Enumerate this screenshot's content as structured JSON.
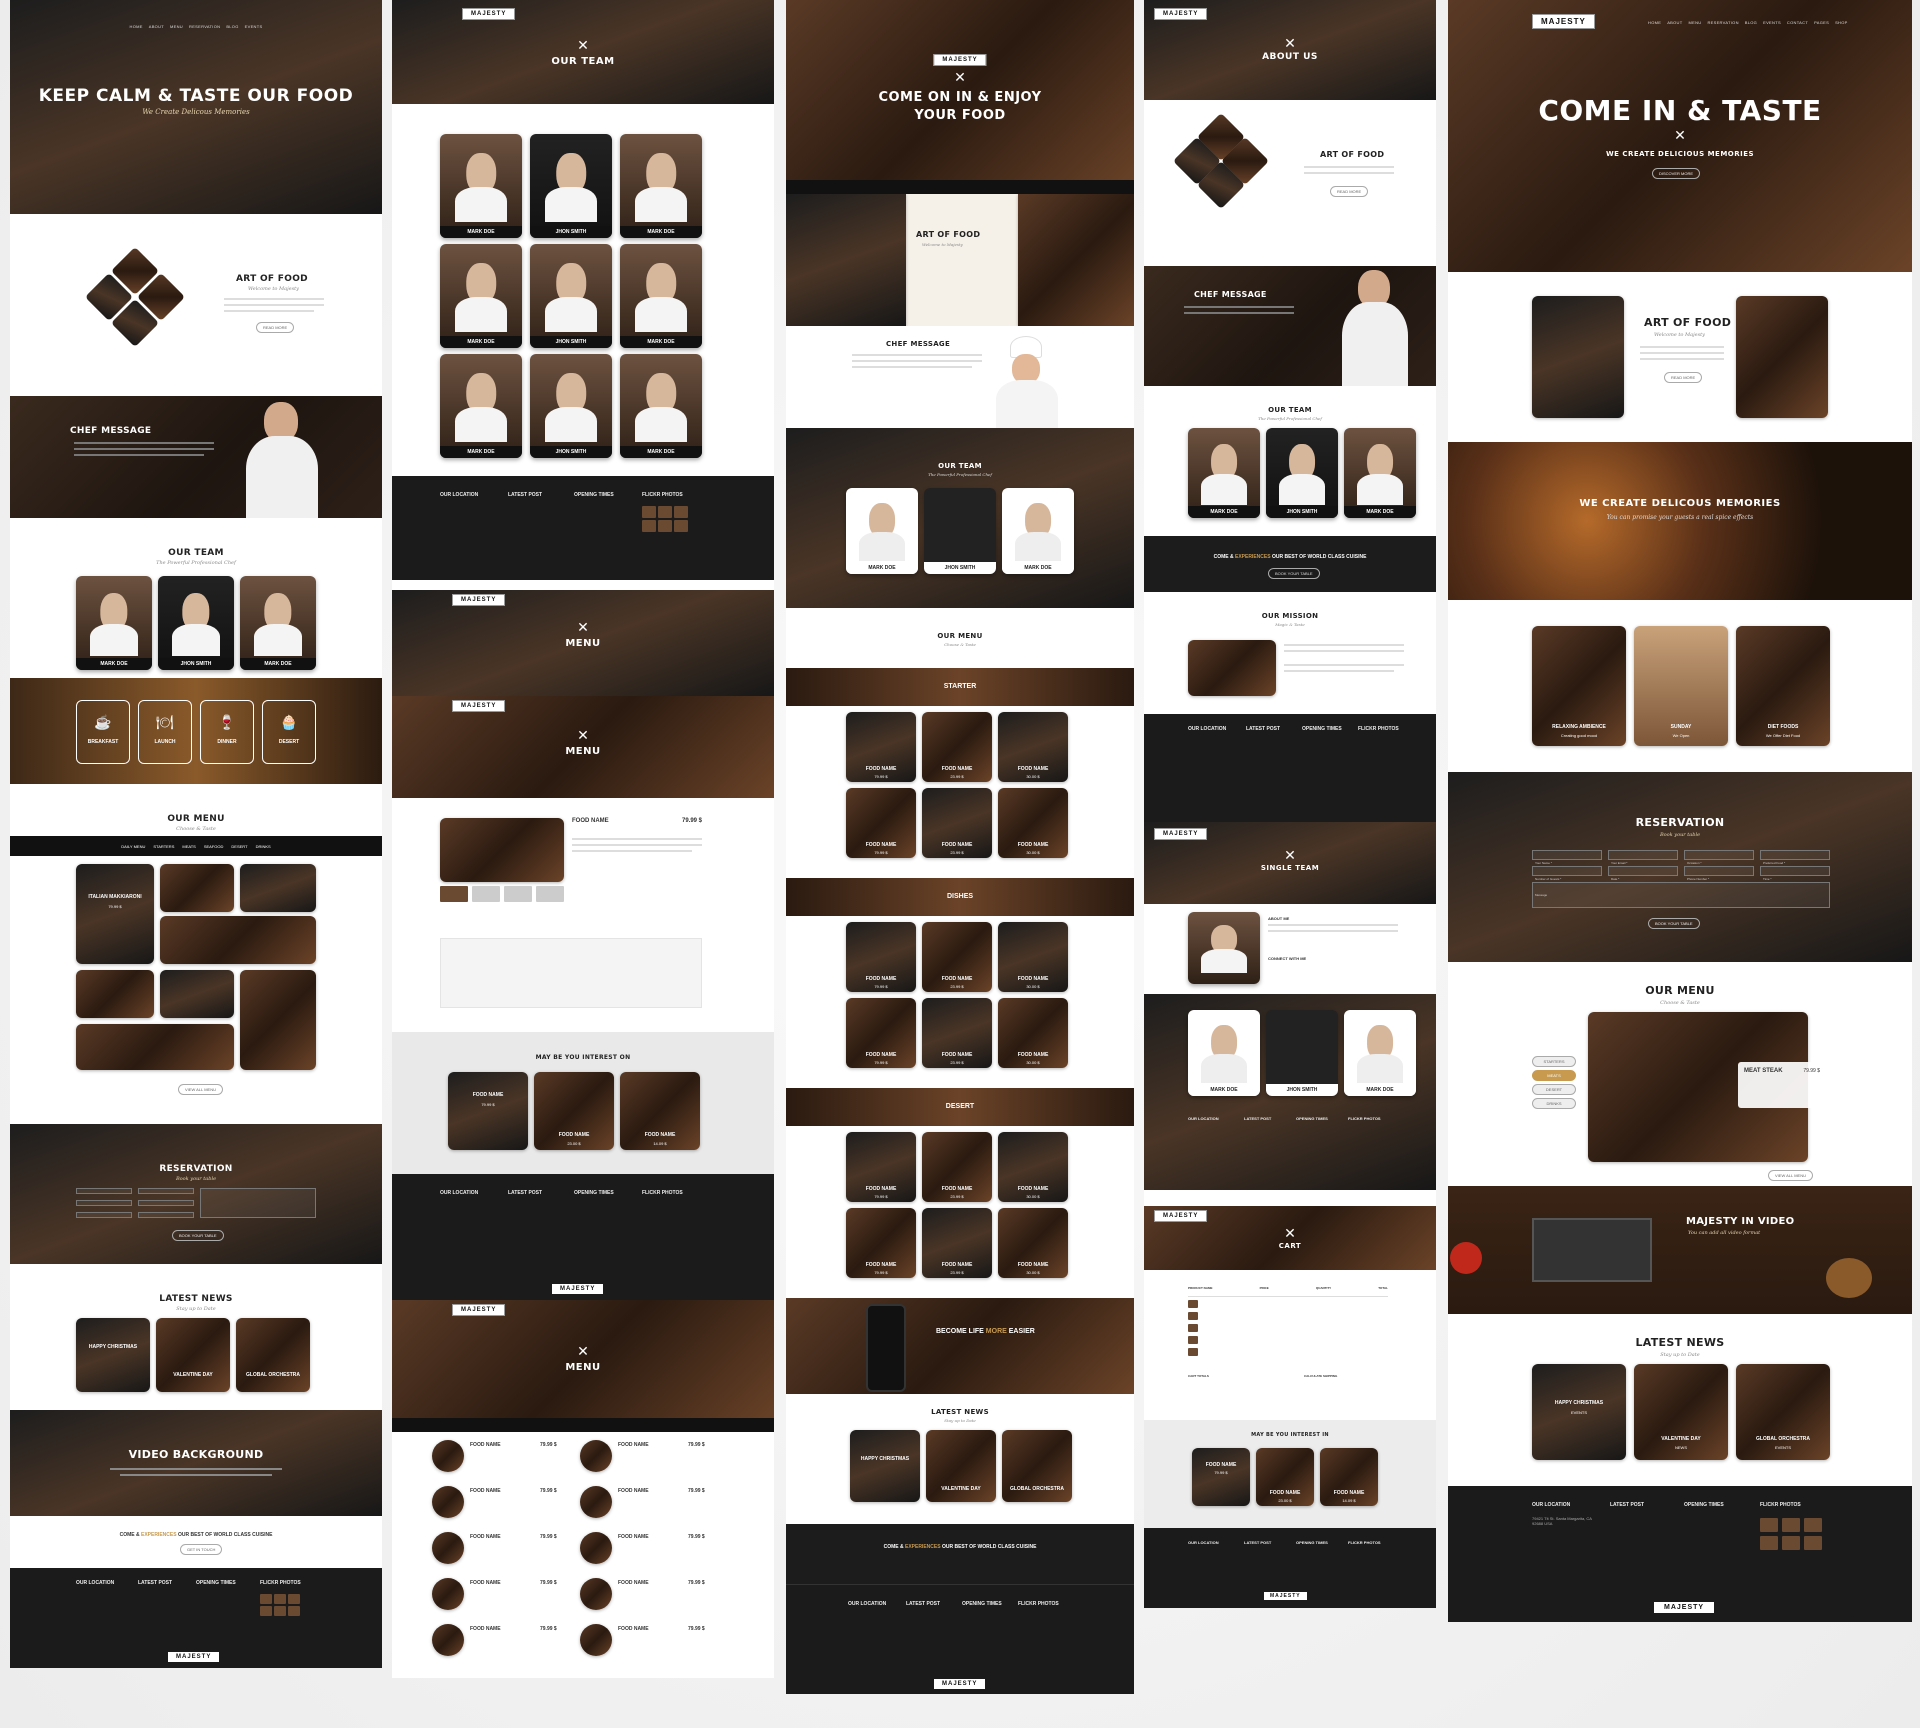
{
  "brand": {
    "logo": "MAJESTY"
  },
  "nav": [
    "HOME",
    "ABOUT",
    "MENU",
    "RESERVATION",
    "BLOG",
    "EVENTS",
    "CONTACT",
    "PAGES",
    "SHOP"
  ],
  "col1": {
    "hero_title": "KEEP CALM & TASTE OUR FOOD",
    "hero_sub": "We Create Delicous Memories",
    "art_title": "ART OF FOOD",
    "art_sub": "Welcome to Majesty",
    "art_btn": "READ MORE",
    "chef_title": "CHEF MESSAGE",
    "team_title": "OUR TEAM",
    "team_sub": "The Powerful Professional Chef",
    "team": [
      {
        "name": "MARK DOE"
      },
      {
        "name": "JHON SMITH"
      },
      {
        "name": "MARK DOE"
      }
    ],
    "meals": [
      {
        "name": "BREAKFAST",
        "icon": "☕"
      },
      {
        "name": "LAUNCH",
        "icon": "🍽"
      },
      {
        "name": "DINNER",
        "icon": "🍷"
      },
      {
        "name": "DESERT",
        "icon": "🧁"
      }
    ],
    "menu_title": "OUR MENU",
    "menu_sub": "Choose & Taste",
    "menu_tabs": [
      "DAILY MENU",
      "STARTERS",
      "MEATS",
      "SEAFOOD",
      "DESERT",
      "DRINKS"
    ],
    "menu_item": "ITALIAN MAKKIARONI",
    "menu_price": "79.99 $",
    "menu_btn": "VIEW ALL MENU",
    "res_title": "RESERVATION",
    "res_sub": "Book your table",
    "res_btn": "BOOK YOUR TABLE",
    "news_title": "LATEST NEWS",
    "news_sub": "Stay up to Date",
    "news": [
      "HAPPY CHRISTMAS",
      "VALENTINE DAY",
      "GLOBAL ORCHESTRA"
    ],
    "video_title": "VIDEO BACKGROUND",
    "cta": {
      "a": "COME &",
      "b": "EXPERIENCES",
      "c": "OUR BEST OF WORLD CLASS CUISINE"
    },
    "cta_btn": "GET IN TOUCH",
    "footer": [
      "OUR LOCATION",
      "LATEST POST",
      "OPENING TIMES",
      "FLICKR PHOTOS"
    ]
  },
  "col2": {
    "team_title": "OUR TEAM",
    "grid": [
      {
        "name": "MARK DOE"
      },
      {
        "name": "JHON SMITH"
      },
      {
        "name": "MARK DOE"
      },
      {
        "name": "MARK DOE"
      },
      {
        "name": "JHON SMITH"
      },
      {
        "name": "MARK DOE"
      },
      {
        "name": "MARK DOE"
      },
      {
        "name": "JHON SMITH"
      },
      {
        "name": "MARK DOE"
      }
    ],
    "footer": [
      "OUR LOCATION",
      "LATEST POST",
      "OPENING TIMES",
      "FLICKR PHOTOS"
    ],
    "menu1": "MENU",
    "menu2": "MENU",
    "food_name": "FOOD NAME",
    "food_price": "79.99 $",
    "interest": "MAY BE YOU INTEREST ON",
    "interest_items": [
      {
        "name": "FOOD NAME",
        "price": "79.99 $"
      },
      {
        "name": "FOOD NAME",
        "price": "23.00 $"
      },
      {
        "name": "FOOD NAME",
        "price": "14.09 $"
      }
    ],
    "menu3": "MENU",
    "menu_list": [
      [
        "FOOD NAME",
        "79.99 $"
      ],
      [
        "FOOD NAME",
        "79.99 $"
      ],
      [
        "FOOD NAME",
        "79.99 $"
      ],
      [
        "FOOD NAME",
        "79.99 $"
      ],
      [
        "FOOD NAME",
        "79.99 $"
      ],
      [
        "FOOD NAME",
        "79.99 $"
      ],
      [
        "FOOD NAME",
        "79.99 $"
      ],
      [
        "FOOD NAME",
        "79.99 $"
      ],
      [
        "FOOD NAME",
        "79.99 $"
      ],
      [
        "FOOD NAME",
        "79.99 $"
      ]
    ]
  },
  "col3": {
    "hero_title_1": "COME ON IN & ENJOY",
    "hero_title_2": "YOUR FOOD",
    "art_title": "ART OF FOOD",
    "art_sub": "Welcome to Majesty",
    "chef_title": "CHEF MESSAGE",
    "team_title": "OUR TEAM",
    "team_sub": "The Powerful Professional Chef",
    "team": [
      {
        "name": "MARK DOE"
      },
      {
        "name": "JHON SMITH"
      },
      {
        "name": "MARK DOE"
      }
    ],
    "menu_title": "OUR MENU",
    "menu_sub": "Choose & Taste",
    "cats": [
      "STARTER",
      "DISHES",
      "DESERT"
    ],
    "food": [
      [
        "FOOD NAME",
        "79.99 $"
      ],
      [
        "FOOD NAME",
        "23.99 $"
      ],
      [
        "FOOD NAME",
        "30.00 $"
      ],
      [
        "FOOD NAME",
        "79.99 $"
      ],
      [
        "FOOD NAME",
        "23.99 $"
      ],
      [
        "FOOD NAME",
        "30.00 $"
      ]
    ],
    "easy": {
      "a": "BECOME LIFE",
      "b": "MORE",
      "c": "EASIER"
    },
    "news_title": "LATEST NEWS",
    "news_sub": "Stay up to Date",
    "news": [
      "HAPPY CHRISTMAS",
      "VALENTINE DAY",
      "GLOBAL ORCHESTRA"
    ],
    "cta": {
      "a": "COME &",
      "b": "EXPERIENCES",
      "c": "OUR BEST OF WORLD CLASS CUISINE"
    },
    "footer": [
      "OUR LOCATION",
      "LATEST POST",
      "OPENING TIMES",
      "FLICKR PHOTOS"
    ]
  },
  "col4": {
    "about_title": "ABOUT US",
    "art_title": "ART OF FOOD",
    "art_btn": "READ MORE",
    "chef_title": "CHEF MESSAGE",
    "team_title": "OUR TEAM",
    "team_sub": "The Powerful Professional Chef",
    "team": [
      {
        "name": "MARK DOE"
      },
      {
        "name": "JHON SMITH"
      },
      {
        "name": "MARK DOE"
      }
    ],
    "cta": {
      "a": "COME &",
      "b": "EXPERIENCES",
      "c": "OUR BEST OF WORLD CLASS CUISINE"
    },
    "cta_btn": "BOOK YOUR TABLE",
    "mission_title": "OUR MISSION",
    "mission_sub": "Magic & Taste",
    "footer": [
      "OUR LOCATION",
      "LATEST POST",
      "OPENING TIMES",
      "FLICKR PHOTOS"
    ],
    "single_title": "SINGLE TEAM",
    "about_me": "ABOUT ME",
    "connect": "CONNECT WITH ME",
    "team2": [
      {
        "name": "MARK DOE"
      },
      {
        "name": "JHON SMITH"
      },
      {
        "name": "MARK DOE"
      }
    ],
    "cart_title": "CART",
    "cart_cols": [
      "PRODUCT NAME",
      "PRICE",
      "QUANTITY",
      "TOTAL"
    ],
    "cart_totals": "CART TOTALS",
    "checkout": "CALCULATE SHIPPING",
    "interest": "MAY BE YOU INTEREST IN",
    "interest_items": [
      {
        "name": "FOOD NAME",
        "price": "79.99 $"
      },
      {
        "name": "FOOD NAME",
        "price": "23.00 $"
      },
      {
        "name": "FOOD NAME",
        "price": "14.09 $"
      }
    ]
  },
  "col5": {
    "hero_title": "COME IN & TASTE",
    "hero_sub": "WE CREATE DELICIOUS MEMORIES",
    "hero_btn": "DISCOVER MORE",
    "art_title": "ART OF FOOD",
    "art_sub": "Welcome to Majesty",
    "art_btn": "READ MORE",
    "mem_title": "WE CREATE DELICOUS MEMORIES",
    "mem_sub": "You can promise your guests a real spice effects",
    "cards": [
      {
        "t": "RELAXING AMBIENCE",
        "s": "Creating good mood"
      },
      {
        "t": "SUNDAY",
        "s": "We Open"
      },
      {
        "t": "DIET FOODS",
        "s": "We Offer Diet Food"
      }
    ],
    "res_title": "RESERVATION",
    "res_sub": "Book your table",
    "res_btn": "BOOK YOUR TABLE",
    "res_fields": [
      "Your Name *",
      "Your Email *",
      "Occasion *",
      "Preferred Food *",
      "Number of Guests *",
      "Date *",
      "Phone Number *",
      "Time *"
    ],
    "res_msg": "Message",
    "menu_title": "OUR MENU",
    "menu_sub": "Choose & Taste",
    "menu_tabs": [
      "STARTERS",
      "MEATS",
      "DESERT",
      "DRINKS"
    ],
    "menu_item": "MEAT STEAK",
    "menu_price": "79.99 $",
    "menu_btn": "VIEW ALL MENU",
    "video_title": "MAJESTY IN VIDEO",
    "video_sub": "You can add all video format",
    "news_title": "LATEST NEWS",
    "news_sub": "Stay up to Date",
    "news": [
      {
        "t": "HAPPY CHRISTMAS",
        "s": "EVENTS"
      },
      {
        "t": "VALENTINE DAY",
        "s": "NEWS"
      },
      {
        "t": "GLOBAL ORCHESTRA",
        "s": "EVENTS"
      }
    ],
    "footer": [
      "OUR LOCATION",
      "LATEST POST",
      "OPENING TIMES",
      "FLICKR PHOTOS"
    ],
    "loc": "79421 Tlt St. Santa Margarita, CA 92688 USA"
  },
  "colors": {
    "accent": "#c79a50",
    "dark": "#1c1c1c",
    "wood": "#2d2018"
  }
}
